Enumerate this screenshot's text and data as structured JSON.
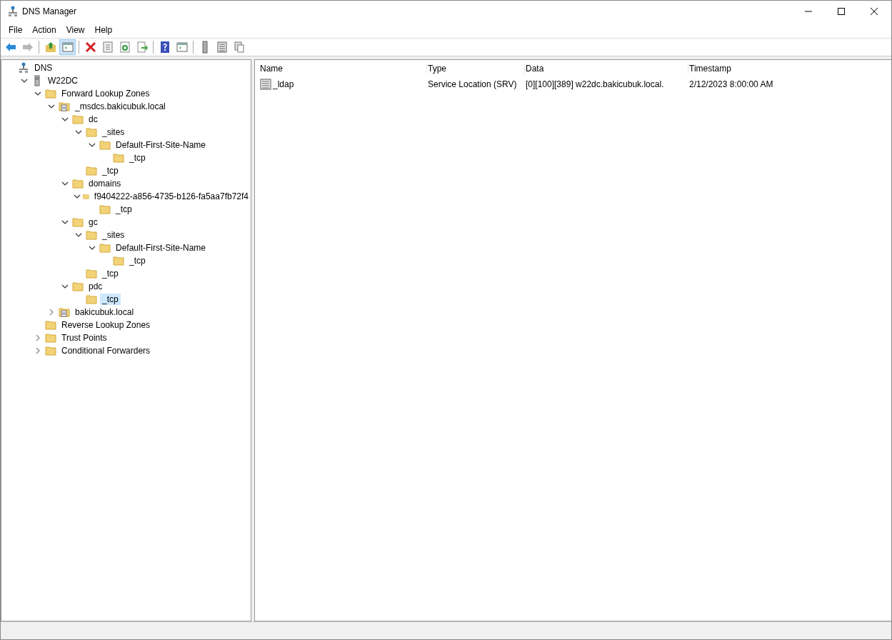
{
  "window": {
    "title": "DNS Manager"
  },
  "menu": [
    "File",
    "Action",
    "View",
    "Help"
  ],
  "toolbar": [
    {
      "kind": "back",
      "pressed": false,
      "disabled": false
    },
    {
      "kind": "forward",
      "pressed": false,
      "disabled": true
    },
    {
      "kind": "up",
      "pressed": false,
      "disabled": false
    },
    {
      "kind": "tree",
      "pressed": true,
      "disabled": false
    },
    {
      "kind": "delete",
      "pressed": false,
      "disabled": false
    },
    {
      "kind": "properties",
      "pressed": false,
      "disabled": false
    },
    {
      "kind": "refresh",
      "pressed": false,
      "disabled": false
    },
    {
      "kind": "export",
      "pressed": false,
      "disabled": false
    },
    {
      "kind": "help",
      "pressed": false,
      "disabled": false
    },
    {
      "kind": "pane",
      "pressed": false,
      "disabled": false
    },
    {
      "kind": "server",
      "pressed": false,
      "disabled": false
    },
    {
      "kind": "list",
      "pressed": false,
      "disabled": false
    },
    {
      "kind": "copy",
      "pressed": false,
      "disabled": false
    }
  ],
  "tree": [
    {
      "label": "DNS",
      "kind": "dns",
      "selected": false,
      "children": [
        {
          "label": "W22DC",
          "kind": "server",
          "expanded": true,
          "selected": false,
          "children": [
            {
              "label": "Forward Lookup Zones",
              "kind": "folder",
              "expanded": true,
              "selected": false,
              "children": [
                {
                  "label": "_msdcs.bakicubuk.local",
                  "kind": "zone",
                  "expanded": true,
                  "selected": false,
                  "children": [
                    {
                      "label": "dc",
                      "kind": "folder",
                      "expanded": true,
                      "selected": false,
                      "children": [
                        {
                          "label": "_sites",
                          "kind": "folder",
                          "expanded": true,
                          "selected": false,
                          "children": [
                            {
                              "label": "Default-First-Site-Name",
                              "kind": "folder",
                              "expanded": true,
                              "selected": false,
                              "children": [
                                {
                                  "label": "_tcp",
                                  "kind": "folder",
                                  "selected": false
                                }
                              ]
                            }
                          ]
                        },
                        {
                          "label": "_tcp",
                          "kind": "folder",
                          "selected": false
                        }
                      ]
                    },
                    {
                      "label": "domains",
                      "kind": "folder",
                      "expanded": true,
                      "selected": false,
                      "children": [
                        {
                          "label": "f9404222-a856-4735-b126-fa5aa7fb72f4",
                          "kind": "folder",
                          "expanded": true,
                          "selected": false,
                          "children": [
                            {
                              "label": "_tcp",
                              "kind": "folder",
                              "selected": false
                            }
                          ]
                        }
                      ]
                    },
                    {
                      "label": "gc",
                      "kind": "folder",
                      "expanded": true,
                      "selected": false,
                      "children": [
                        {
                          "label": "_sites",
                          "kind": "folder",
                          "expanded": true,
                          "selected": false,
                          "children": [
                            {
                              "label": "Default-First-Site-Name",
                              "kind": "folder",
                              "expanded": true,
                              "selected": false,
                              "children": [
                                {
                                  "label": "_tcp",
                                  "kind": "folder",
                                  "selected": false
                                }
                              ]
                            }
                          ]
                        },
                        {
                          "label": "_tcp",
                          "kind": "folder",
                          "selected": false
                        }
                      ]
                    },
                    {
                      "label": "pdc",
                      "kind": "folder",
                      "expanded": true,
                      "selected": false,
                      "children": [
                        {
                          "label": "_tcp",
                          "kind": "folder",
                          "selected": true
                        }
                      ]
                    }
                  ]
                },
                {
                  "label": "bakicubuk.local",
                  "kind": "zone",
                  "expanded": false,
                  "selected": false
                }
              ]
            },
            {
              "label": "Reverse Lookup Zones",
              "kind": "folder",
              "selected": false
            },
            {
              "label": "Trust Points",
              "kind": "folder",
              "expanded": false,
              "selected": false
            },
            {
              "label": "Conditional Forwarders",
              "kind": "folder",
              "expanded": false,
              "selected": false
            }
          ]
        }
      ]
    }
  ],
  "table": {
    "columns": [
      "Name",
      "Type",
      "Data",
      "Timestamp"
    ],
    "rows": [
      {
        "cells": [
          "_ldap",
          "Service Location (SRV)",
          "[0][100][389] w22dc.bakicubuk.local.",
          "2/12/2023 8:00:00 AM"
        ],
        "selected": false
      }
    ]
  }
}
